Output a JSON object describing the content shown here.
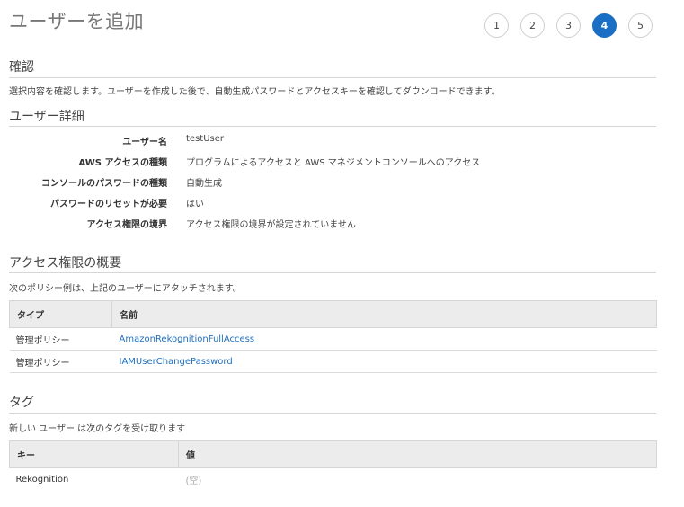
{
  "header": {
    "title": "ユーザーを追加",
    "steps": [
      "1",
      "2",
      "3",
      "4",
      "5"
    ],
    "active_step": "4"
  },
  "confirm": {
    "title": "確認",
    "description": "選択内容を確認します。ユーザーを作成した後で、自動生成パスワードとアクセスキーを確認してダウンロードできます。"
  },
  "user_details": {
    "title": "ユーザー詳細",
    "rows": [
      {
        "label": "ユーザー名",
        "value": "testUser"
      },
      {
        "label": "AWS アクセスの種類",
        "value": "プログラムによるアクセスと AWS マネジメントコンソールへのアクセス"
      },
      {
        "label": "コンソールのパスワードの種類",
        "value": "自動生成"
      },
      {
        "label": "パスワードのリセットが必要",
        "value": "はい"
      },
      {
        "label": "アクセス権限の境界",
        "value": "アクセス権限の境界が設定されていません"
      }
    ]
  },
  "permissions": {
    "title": "アクセス権限の概要",
    "description": "次のポリシー例は、上記のユーザーにアタッチされます。",
    "columns": [
      "タイプ",
      "名前"
    ],
    "rows": [
      {
        "type": "管理ポリシー",
        "name": "AmazonRekognitionFullAccess"
      },
      {
        "type": "管理ポリシー",
        "name": "IAMUserChangePassword"
      }
    ]
  },
  "tags": {
    "title": "タグ",
    "description": "新しい ユーザー は次のタグを受け取ります",
    "columns": [
      "キー",
      "値"
    ],
    "rows": [
      {
        "key": "Rekognition",
        "value": "(空)"
      }
    ]
  },
  "colors": {
    "accent": "#1a6ec3",
    "link": "#1f6fbe",
    "header_bg": "#ececec"
  }
}
